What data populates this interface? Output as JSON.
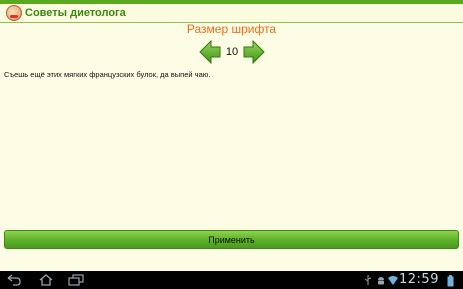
{
  "app": {
    "title": "Советы диетолога",
    "icon": "dietitian-logo-icon"
  },
  "settings": {
    "heading": "Размер шрифта",
    "font_size": "10",
    "decrease_icon": "arrow-left-icon",
    "increase_icon": "arrow-right-icon",
    "sample_text": "Съешь ещё этих мягких французских булок, да выпей чаю.",
    "apply_label": "Применить"
  },
  "system_bar": {
    "back_icon": "back-icon",
    "home_icon": "home-icon",
    "recents_icon": "recent-apps-icon",
    "usb_icon": "usb-icon",
    "android_icon": "android-debug-icon",
    "wifi_icon": "wifi-icon",
    "battery_icon": "battery-icon",
    "time": "12:59"
  },
  "colors": {
    "accent_green": "#5aa81e",
    "title_green": "#3a8a0e",
    "heading_orange": "#f06b1a",
    "background": "#fdfde6"
  }
}
